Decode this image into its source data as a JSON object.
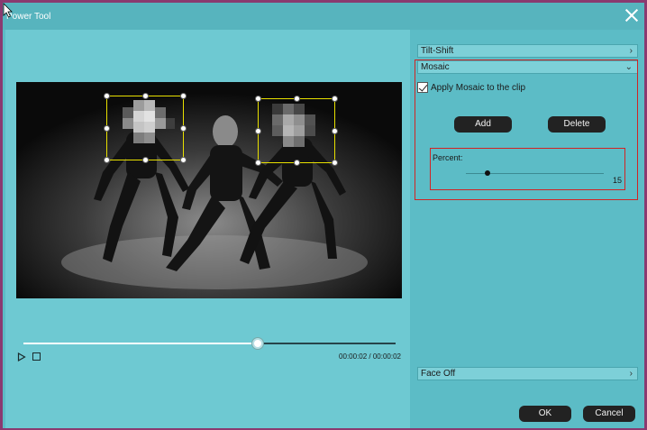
{
  "window": {
    "title": "Power Tool"
  },
  "player": {
    "time_display": "00:00:02 / 00:00:02",
    "progress": 0.63
  },
  "panel": {
    "tilt_shift_label": "Tilt-Shift",
    "mosaic_label": "Mosaic",
    "apply_mosaic_label": "Apply Mosaic to the clip",
    "apply_mosaic_checked": true,
    "add_label": "Add",
    "delete_label": "Delete",
    "percent_label": "Percent:",
    "percent_value": "15",
    "percent_fraction": 0.16,
    "face_off_label": "Face Off"
  },
  "footer": {
    "ok_label": "OK",
    "cancel_label": "Cancel"
  },
  "colors": {
    "highlight": "#d22323",
    "selection": "#e8e000",
    "accent": "#5cbcc6"
  }
}
